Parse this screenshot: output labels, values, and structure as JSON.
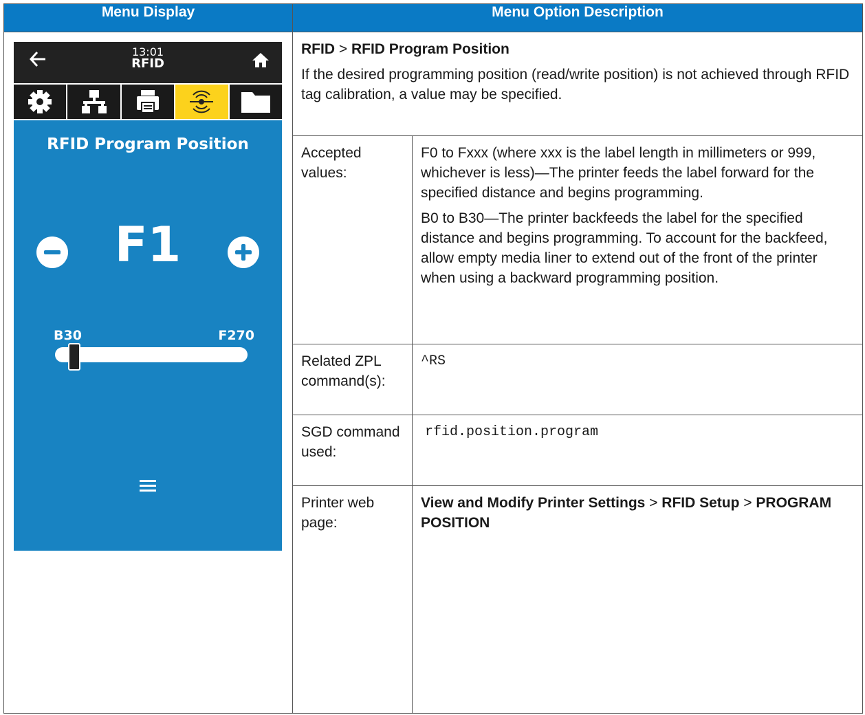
{
  "headers": {
    "left": "Menu Display",
    "right": "Menu Option Description"
  },
  "display": {
    "time": "13:01",
    "section": "RFID",
    "icons": [
      "settings-icon",
      "network-icon",
      "printer-icon",
      "rfid-icon",
      "folder-icon"
    ],
    "active_icon": "rfid-icon",
    "screen_title": "RFID Program Position",
    "value": "F1",
    "range_min_label": "B30",
    "range_max_label": "F270",
    "slider_fraction": 0.1,
    "colors": {
      "accent": "#1883c2",
      "active_tab": "#fcd21c",
      "header": "#0a7ac5"
    }
  },
  "description": {
    "path_first": "RFID",
    "path_sep": ">",
    "path_second": "RFID Program Position",
    "intro": "If the desired programming position (read/write position) is not achieved through RFID tag calibration, a value may be specified.",
    "rows": [
      {
        "label": "Accepted values:",
        "p1": "F0 to Fxxx (where xxx is the label length in millimeters or 999, whichever is less)—The printer feeds the label forward for the specified distance and begins programming.",
        "p2": "B0 to B30—The printer backfeeds the label for the specified distance and begins programming. To account for the backfeed, allow empty media liner to extend out of the front of the printer when using a backward programming position."
      },
      {
        "label": "Related ZPL command(s):",
        "value": "^RS"
      },
      {
        "label": "SGD command used:",
        "value": "rfid.position.program"
      },
      {
        "label": "Printer web page:",
        "web_a": "View and Modify Printer Settings",
        "web_sep1": ">",
        "web_b": "RFID Setup",
        "web_sep2": ">",
        "web_c": "PROGRAM POSITION"
      }
    ]
  }
}
